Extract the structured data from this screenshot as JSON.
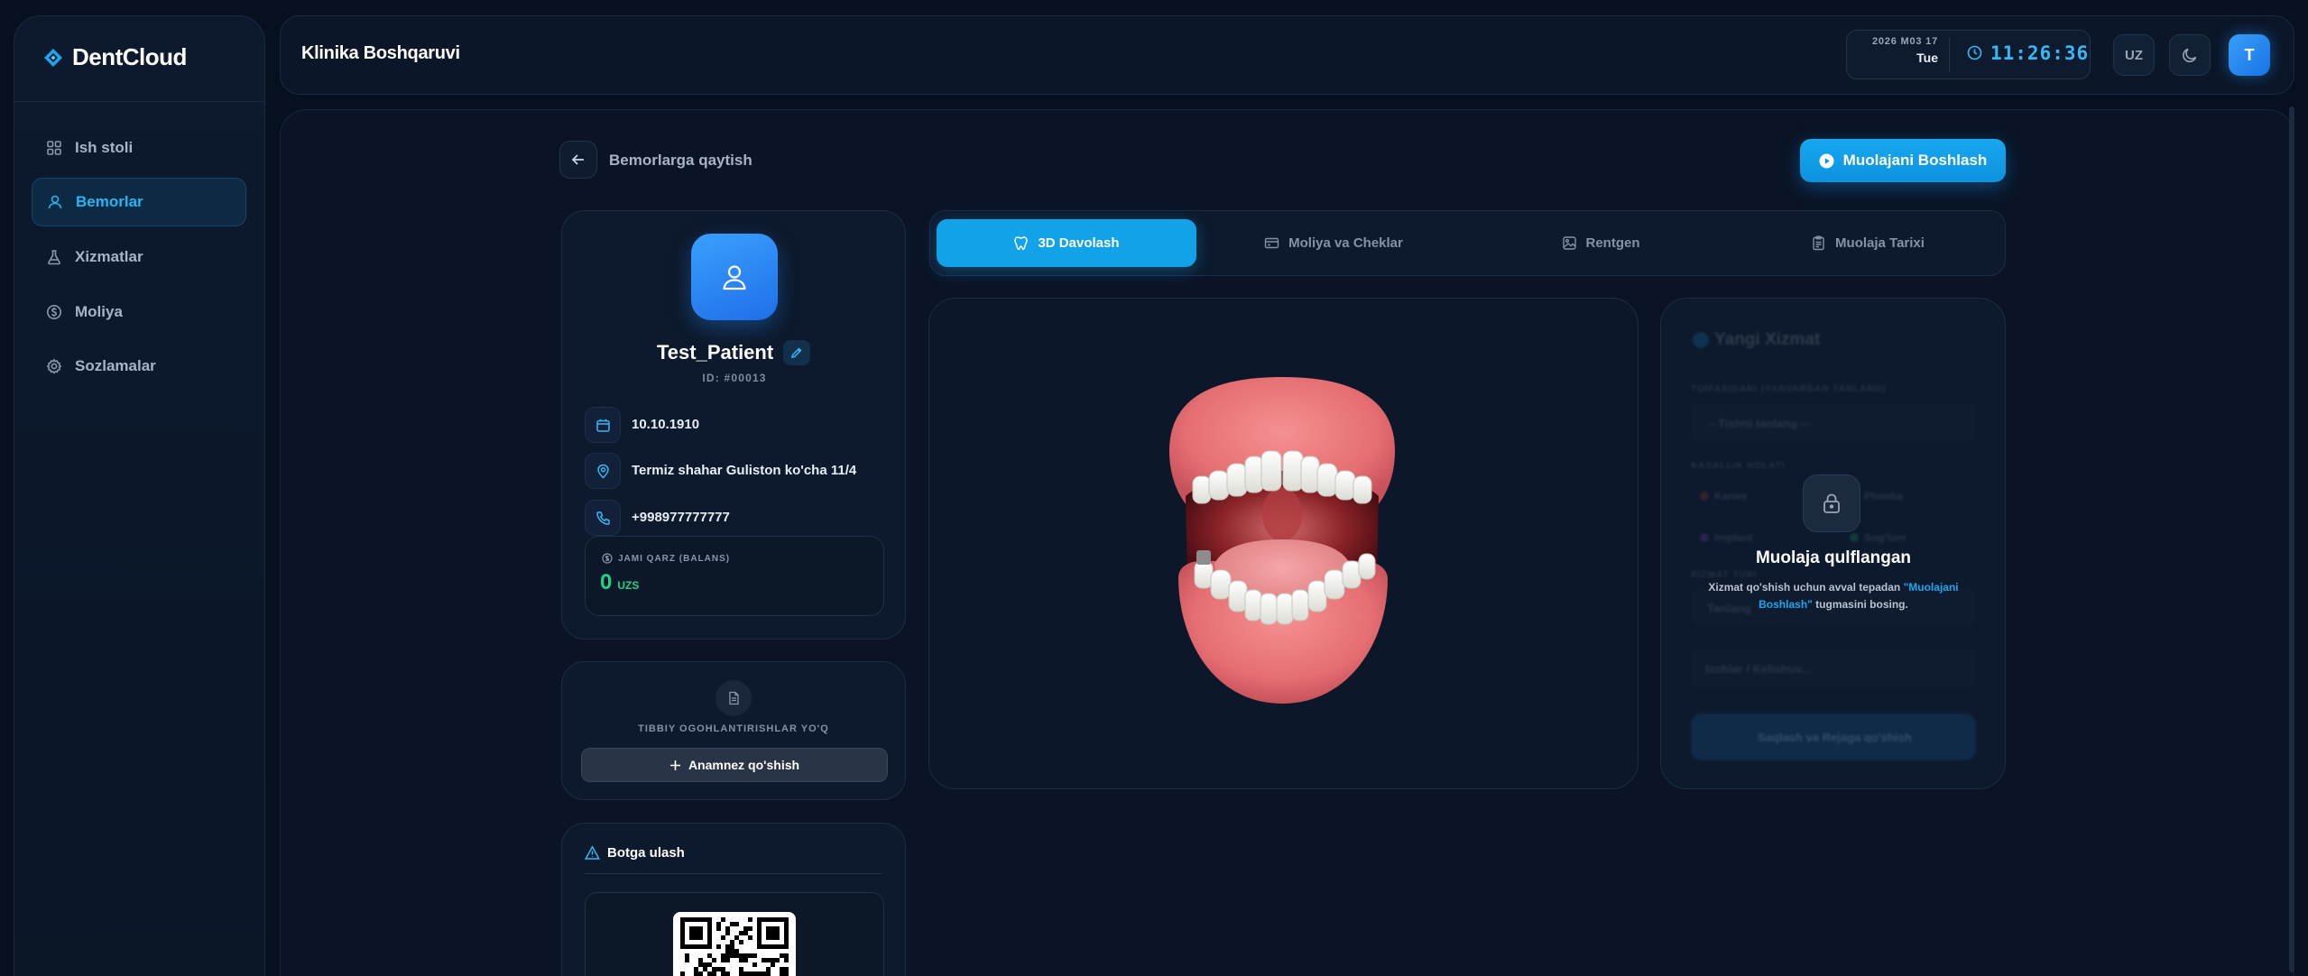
{
  "brand": {
    "name": "DentCloud"
  },
  "sidebar": {
    "items": [
      {
        "label": "Ish stoli",
        "icon": "grid-icon",
        "active": false
      },
      {
        "label": "Bemorlar",
        "icon": "users-icon",
        "active": true
      },
      {
        "label": "Xizmatlar",
        "icon": "flask-icon",
        "active": false
      },
      {
        "label": "Moliya",
        "icon": "dollar-circle-icon",
        "active": false
      },
      {
        "label": "Sozlamalar",
        "icon": "gear-icon",
        "active": false
      }
    ]
  },
  "header": {
    "title": "Klinika Boshqaruvi",
    "date_line": "2026 M03 17",
    "day_line": "Tue",
    "time": "11:26:36",
    "language": "UZ",
    "avatar_initial": "T"
  },
  "page": {
    "back_label": "Bemorlarga qaytish",
    "start_button": "Muolajani Boshlash"
  },
  "patient": {
    "name": "Test_Patient",
    "id_label": "ID: #00013",
    "birth_date": "10.10.1910",
    "address": "Termiz shahar Guliston ko'cha 11/4",
    "phone": "+998977777777",
    "debt_label": "JAMI QARZ (BALANS)",
    "debt_value": "0",
    "debt_unit": "UZS"
  },
  "medical": {
    "warning_text": "TIBBIY OGOHLANTIRISHLAR YO'Q",
    "add_button": "Anamnez qo'shish"
  },
  "bot": {
    "title": "Botga ulash"
  },
  "tabs": [
    {
      "label": "3D Davolash",
      "icon": "tooth-icon",
      "active": true
    },
    {
      "label": "Moliya va Cheklar",
      "icon": "card-icon",
      "active": false
    },
    {
      "label": "Rentgen",
      "icon": "image-icon",
      "active": false
    },
    {
      "label": "Muolaja Tarixi",
      "icon": "clipboard-icon",
      "active": false
    }
  ],
  "service_panel": {
    "title": "Yangi Xizmat",
    "category_label": "TOIFASIDANI (YANVARDAN TANLANG)",
    "category_placeholder": "-- Tishni tanlang --",
    "status_label": "KASALLIK HOLATI",
    "status_options": [
      "Karies",
      "Plomba",
      "Implant",
      "Sog'lom"
    ],
    "service_label": "XIZMAT TURI",
    "service_placeholder": "Tanlang",
    "note_placeholder": "Izohlar / Kelishuv...",
    "submit_label": "Saqlash va Rejaga qo'shish",
    "lock_title": "Muolaja qulflangan",
    "lock_desc_prefix": "Xizmat qo'shish uchun avval tepadan ",
    "lock_desc_highlight": "\"Muolajani Boshlash\"",
    "lock_desc_suffix": " tugmasini bosing."
  },
  "colors": {
    "accent": "#12a2e8",
    "success": "#1fd28a",
    "background": "#07101f"
  }
}
